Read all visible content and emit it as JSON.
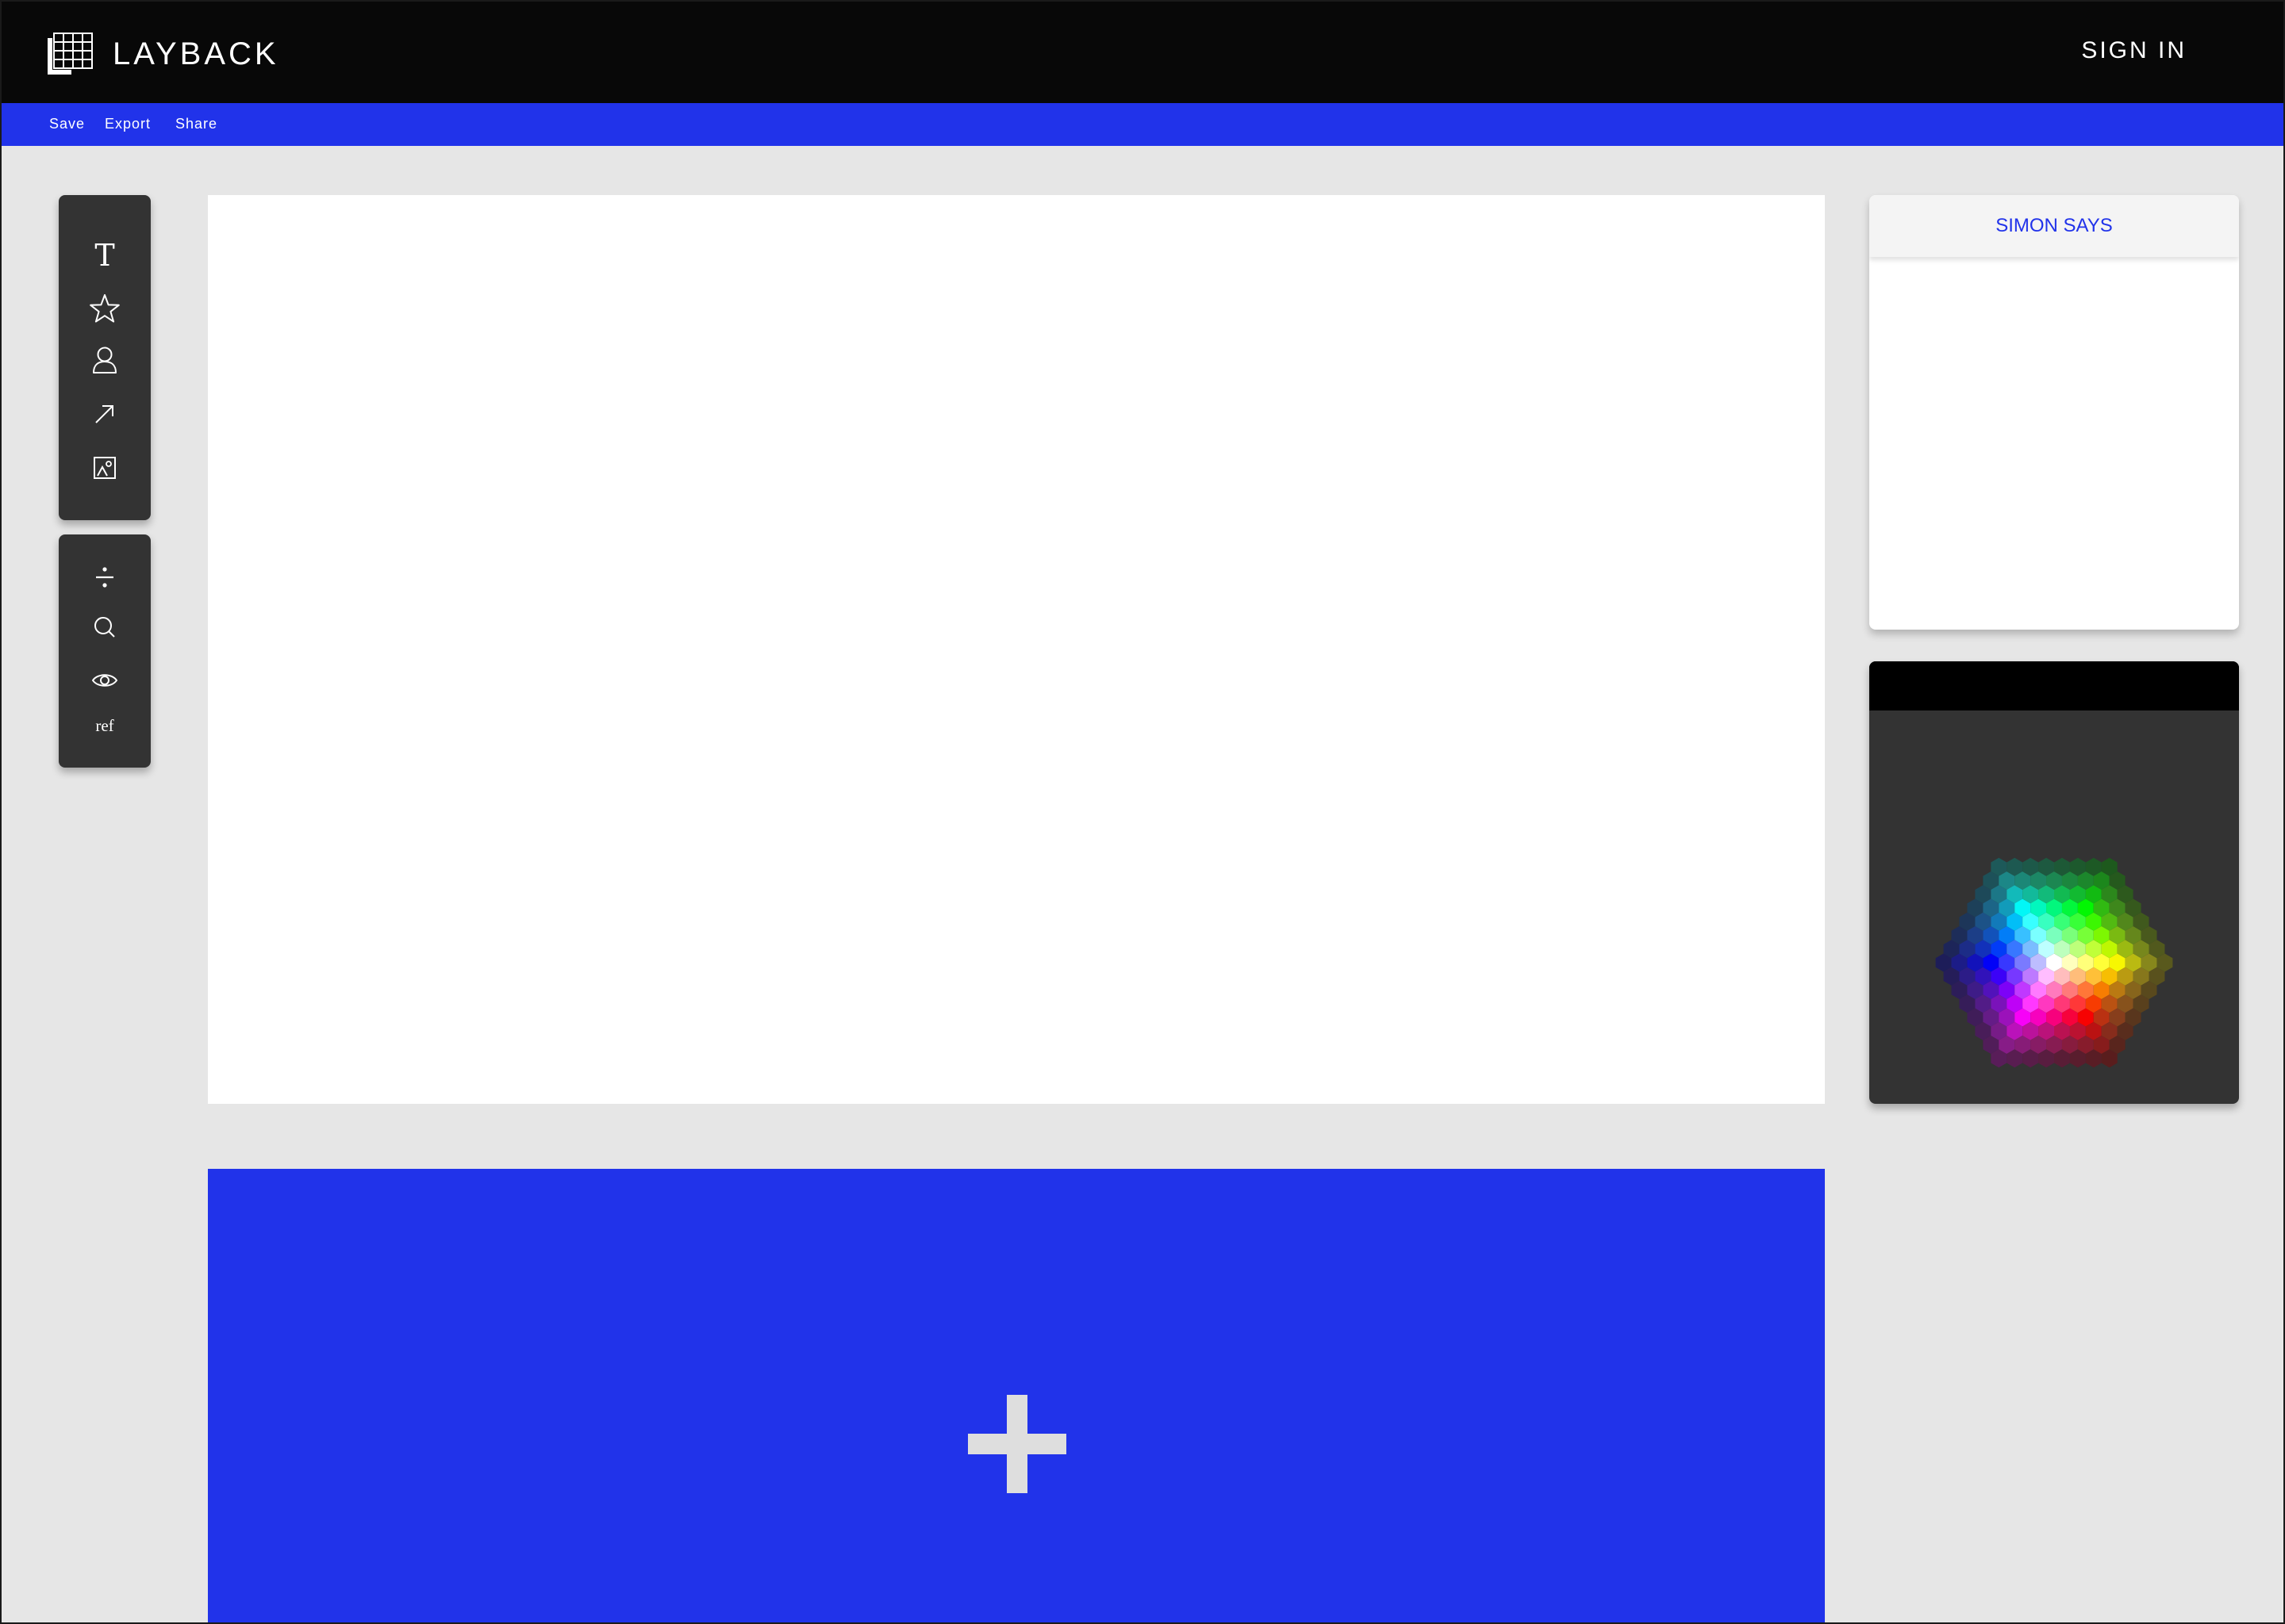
{
  "header": {
    "brand": "LAYBACK",
    "sign_in": "SIGN IN"
  },
  "actions": {
    "save": "Save",
    "export": "Export",
    "share": "Share"
  },
  "tools": {
    "panel_a": [
      "text-tool",
      "star-tool",
      "person-tool",
      "arrow-tool",
      "image-tool"
    ],
    "panel_b": [
      "divide-tool",
      "search-tool",
      "eye-tool",
      "ref-tool"
    ],
    "text_glyph": "T",
    "ref_label": "ref"
  },
  "simon": {
    "title": "SIMON SAYS"
  },
  "colors_theme": {
    "accent": "#2133ea",
    "topbar": "#080808",
    "panel": "#333333",
    "background": "#e6e6e6"
  }
}
